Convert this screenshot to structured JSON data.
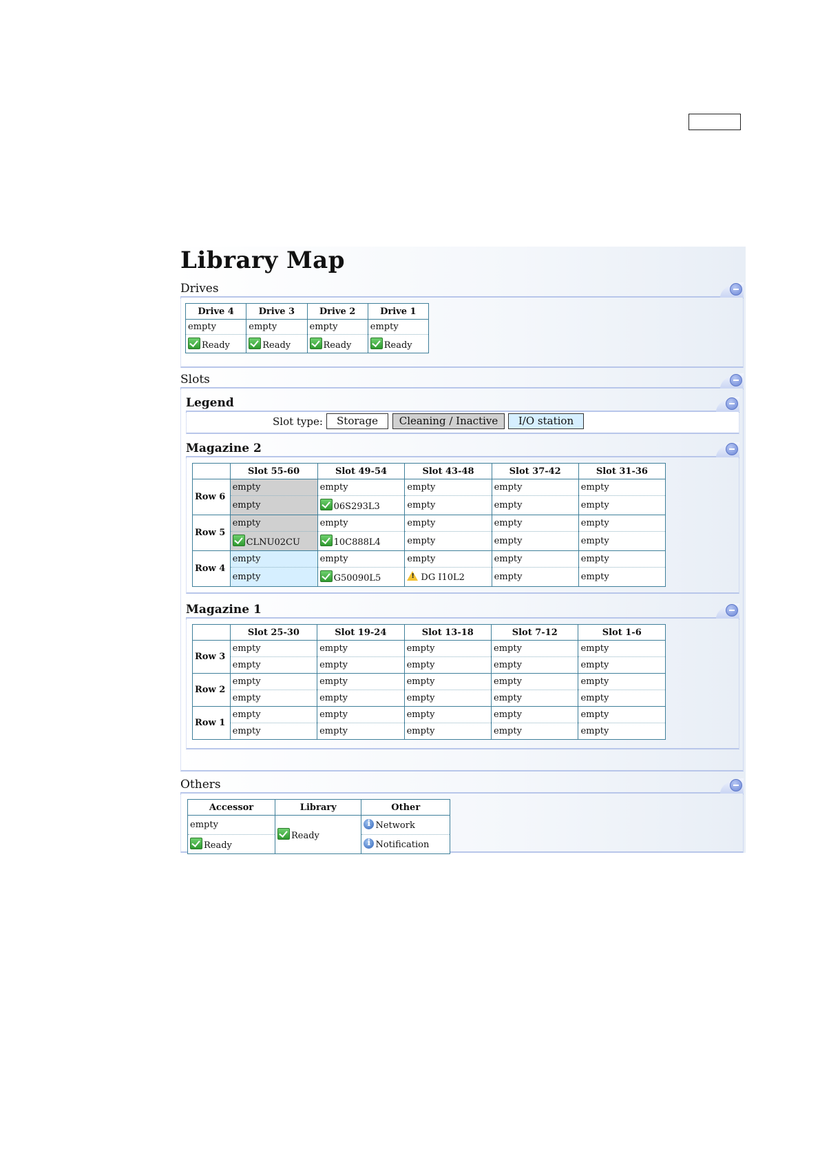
{
  "title": "Library Map",
  "sections": {
    "drives": "Drives",
    "slots": "Slots",
    "legend": "Legend",
    "magazine2": "Magazine 2",
    "magazine1": "Magazine 1",
    "others": "Others"
  },
  "drives": {
    "headers": [
      "Drive 4",
      "Drive 3",
      "Drive 2",
      "Drive 1"
    ],
    "media": [
      "empty",
      "empty",
      "empty",
      "empty"
    ],
    "status": [
      "Ready",
      "Ready",
      "Ready",
      "Ready"
    ]
  },
  "legend": {
    "label": "Slot type:",
    "storage": "Storage",
    "cleaning": "Cleaning / Inactive",
    "io": "I/O station",
    "colors": {
      "storage": "#ffffff",
      "cleaning": "#d0d0d0",
      "io": "#d6efff"
    }
  },
  "magazine2": {
    "headers": [
      "",
      "Slot 55-60",
      "Slot 49-54",
      "Slot 43-48",
      "Slot 37-42",
      "Slot 31-36"
    ],
    "rows": [
      {
        "label": "Row 6",
        "a": [
          "empty",
          "empty",
          "empty",
          "empty",
          "empty"
        ],
        "b": [
          "empty",
          "06S293L3",
          "empty",
          "empty",
          "empty"
        ]
      },
      {
        "label": "Row 5",
        "a": [
          "empty",
          "empty",
          "empty",
          "empty",
          "empty"
        ],
        "b": [
          "CLNU02CU",
          "10C888L4",
          "empty",
          "empty",
          "empty"
        ]
      },
      {
        "label": "Row 4",
        "a": [
          "empty",
          "empty",
          "empty",
          "empty",
          "empty"
        ],
        "b": [
          "empty",
          "G50090L5",
          "DG I10L2",
          "empty",
          "empty"
        ]
      }
    ]
  },
  "magazine1": {
    "headers": [
      "",
      "Slot 25-30",
      "Slot 19-24",
      "Slot 13-18",
      "Slot 7-12",
      "Slot 1-6"
    ],
    "rows": [
      {
        "label": "Row 3",
        "a": [
          "empty",
          "empty",
          "empty",
          "empty",
          "empty"
        ],
        "b": [
          "empty",
          "empty",
          "empty",
          "empty",
          "empty"
        ]
      },
      {
        "label": "Row 2",
        "a": [
          "empty",
          "empty",
          "empty",
          "empty",
          "empty"
        ],
        "b": [
          "empty",
          "empty",
          "empty",
          "empty",
          "empty"
        ]
      },
      {
        "label": "Row 1",
        "a": [
          "empty",
          "empty",
          "empty",
          "empty",
          "empty"
        ],
        "b": [
          "empty",
          "empty",
          "empty",
          "empty",
          "empty"
        ]
      }
    ]
  },
  "others": {
    "headers": [
      "Accessor",
      "Library",
      "Other"
    ],
    "accessor_media": "empty",
    "accessor_status": "Ready",
    "library_status": "Ready",
    "other_items": [
      "Network",
      "Notification"
    ]
  }
}
